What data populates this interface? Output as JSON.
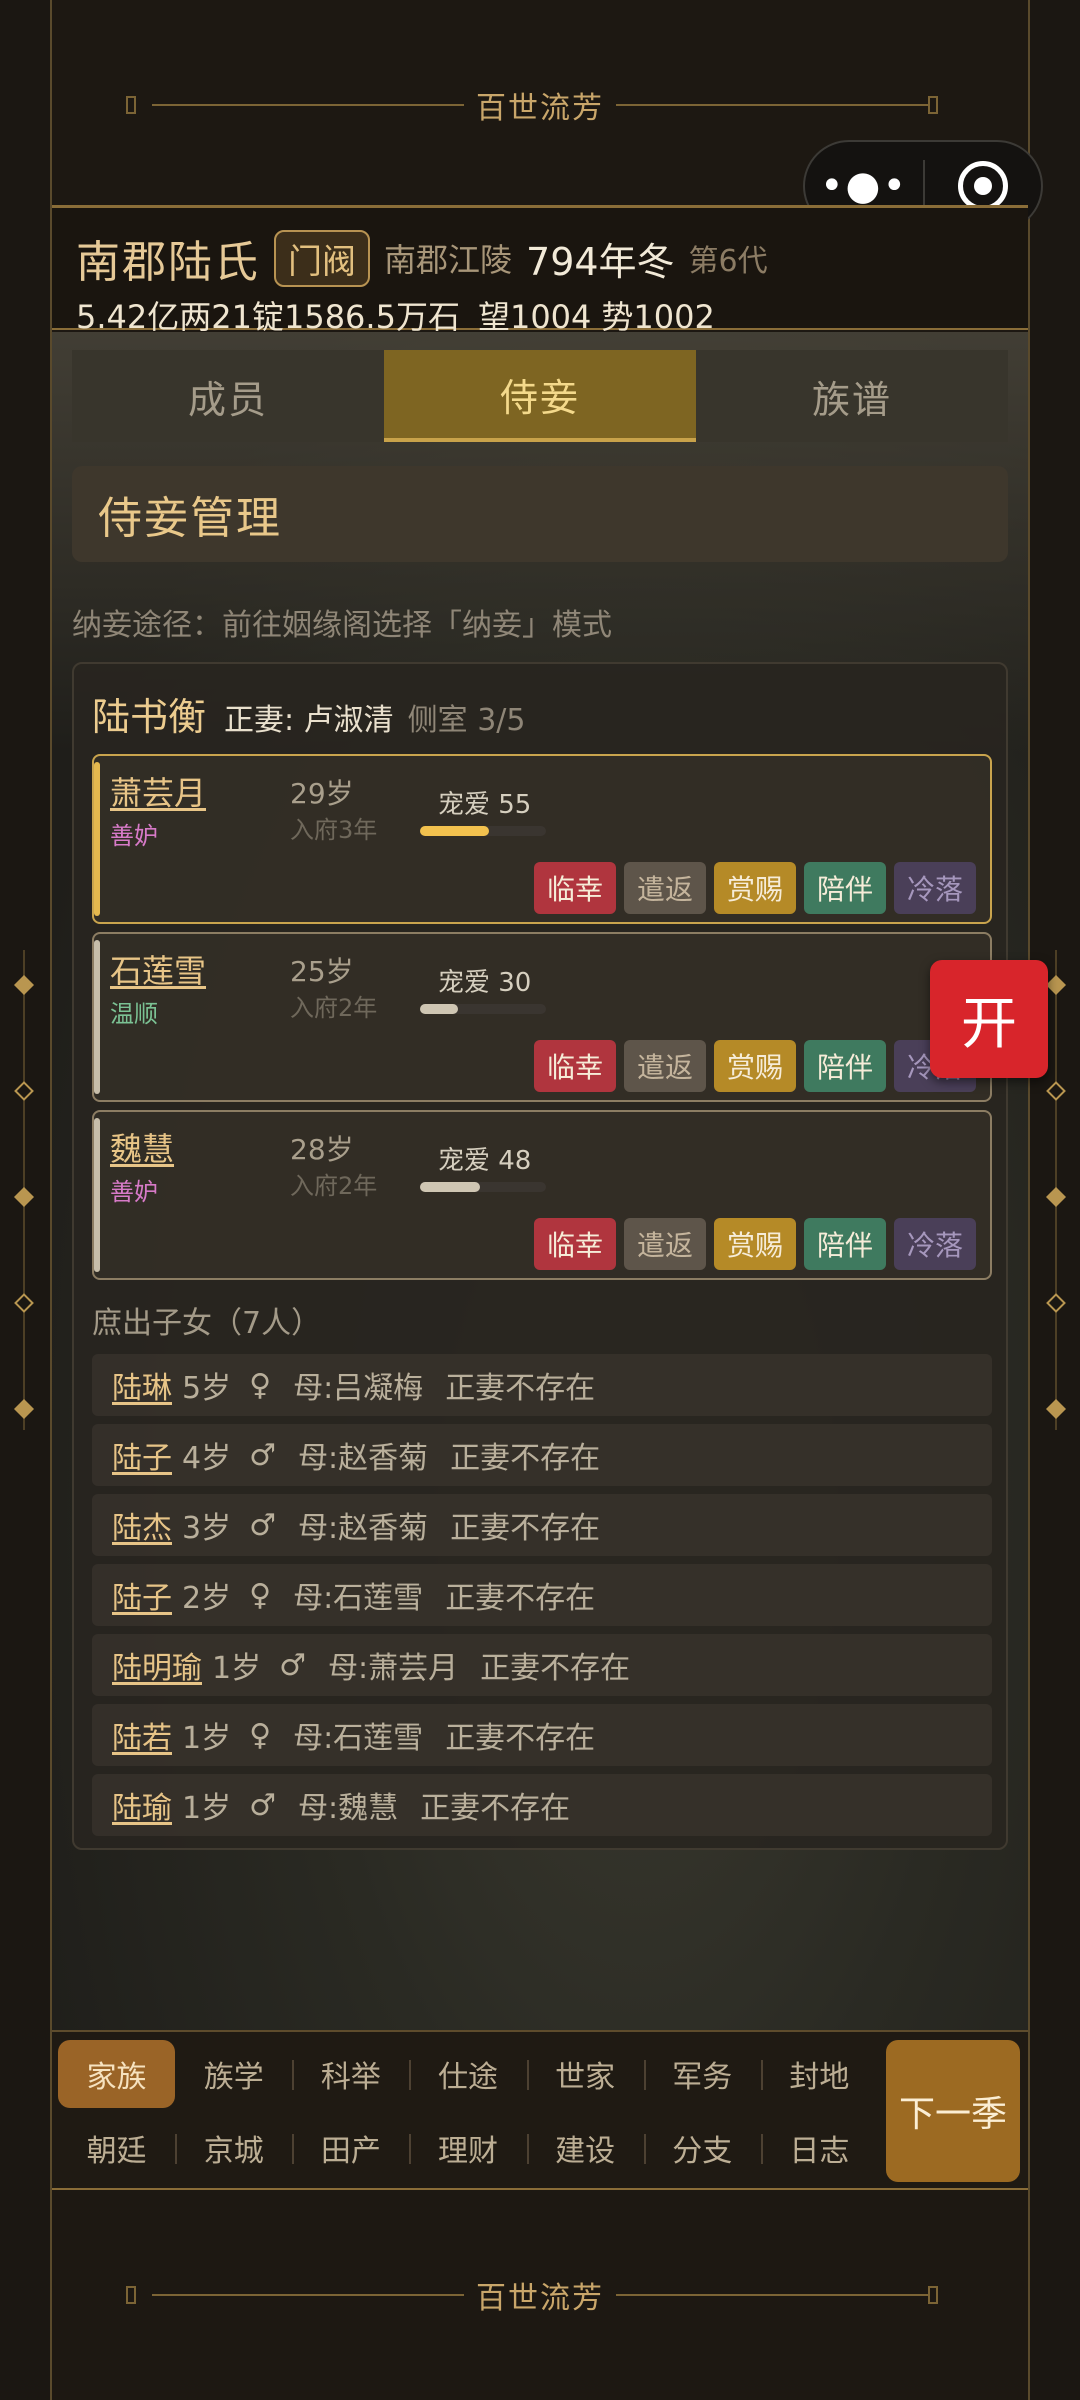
{
  "banner": {
    "title": "百世流芳"
  },
  "capsule": {
    "more_icon": "more-dots-icon",
    "close_icon": "target-circle-icon",
    "dots": "•●•"
  },
  "header": {
    "clan_name": "南郡陆氏",
    "rank": "门阀",
    "location": "南郡江陵",
    "year": "794年冬",
    "generation": "第6代",
    "money": "5.42亿两21锭1586.5万石",
    "prestige": "望1004",
    "power": "势1002"
  },
  "tabs": [
    {
      "label": "成员",
      "active": false
    },
    {
      "label": "侍妾",
      "active": true
    },
    {
      "label": "族谱",
      "active": false
    }
  ],
  "panel": {
    "title": "侍妾管理",
    "hint": "纳妾途径：前往姻缘阁选择「纳妾」模式"
  },
  "lord": {
    "name": "陆书衡",
    "wife": "正妻: 卢淑清",
    "count": "侧室 3/5"
  },
  "concubines": [
    {
      "name": "萧芸月",
      "trait": "善妒",
      "trait_color": "#d77ac8",
      "age": "29岁",
      "years": "入府3年",
      "favor_label": "宠爱 55",
      "favor": 55,
      "selected": true
    },
    {
      "name": "石莲雪",
      "trait": "温顺",
      "trait_color": "#7bc294",
      "age": "25岁",
      "years": "入府2年",
      "favor_label": "宠爱 30",
      "favor": 30,
      "selected": false
    },
    {
      "name": "魏慧",
      "trait": "善妒",
      "trait_color": "#d77ac8",
      "age": "28岁",
      "years": "入府2年",
      "favor_label": "宠爱 48",
      "favor": 48,
      "selected": false
    }
  ],
  "concubine_actions": [
    "临幸",
    "遣返",
    "赏赐",
    "陪伴",
    "冷落"
  ],
  "children": {
    "title": "庶出子女（7人）",
    "items": [
      {
        "name": "陆琳",
        "age": "5岁",
        "sex": "♀",
        "mother": "母:吕凝梅",
        "status": "正妻不存在"
      },
      {
        "name": "陆子",
        "age": "4岁",
        "sex": "♂",
        "mother": "母:赵香菊",
        "status": "正妻不存在"
      },
      {
        "name": "陆杰",
        "age": "3岁",
        "sex": "♂",
        "mother": "母:赵香菊",
        "status": "正妻不存在"
      },
      {
        "name": "陆子",
        "age": "2岁",
        "sex": "♀",
        "mother": "母:石莲雪",
        "status": "正妻不存在"
      },
      {
        "name": "陆明瑜",
        "age": "1岁",
        "sex": "♂",
        "mother": "母:萧芸月",
        "status": "正妻不存在"
      },
      {
        "name": "陆若",
        "age": "1岁",
        "sex": "♀",
        "mother": "母:石莲雪",
        "status": "正妻不存在"
      },
      {
        "name": "陆瑜",
        "age": "1岁",
        "sex": "♂",
        "mother": "母:魏慧",
        "status": "正妻不存在"
      }
    ]
  },
  "float_button": "开",
  "nav": {
    "row1": [
      "家族",
      "族学",
      "科举",
      "仕途",
      "世家",
      "军务",
      "封地"
    ],
    "row2": [
      "朝廷",
      "京城",
      "田产",
      "理财",
      "建设",
      "分支",
      "日志"
    ],
    "active": "家族",
    "next": "下一季"
  }
}
